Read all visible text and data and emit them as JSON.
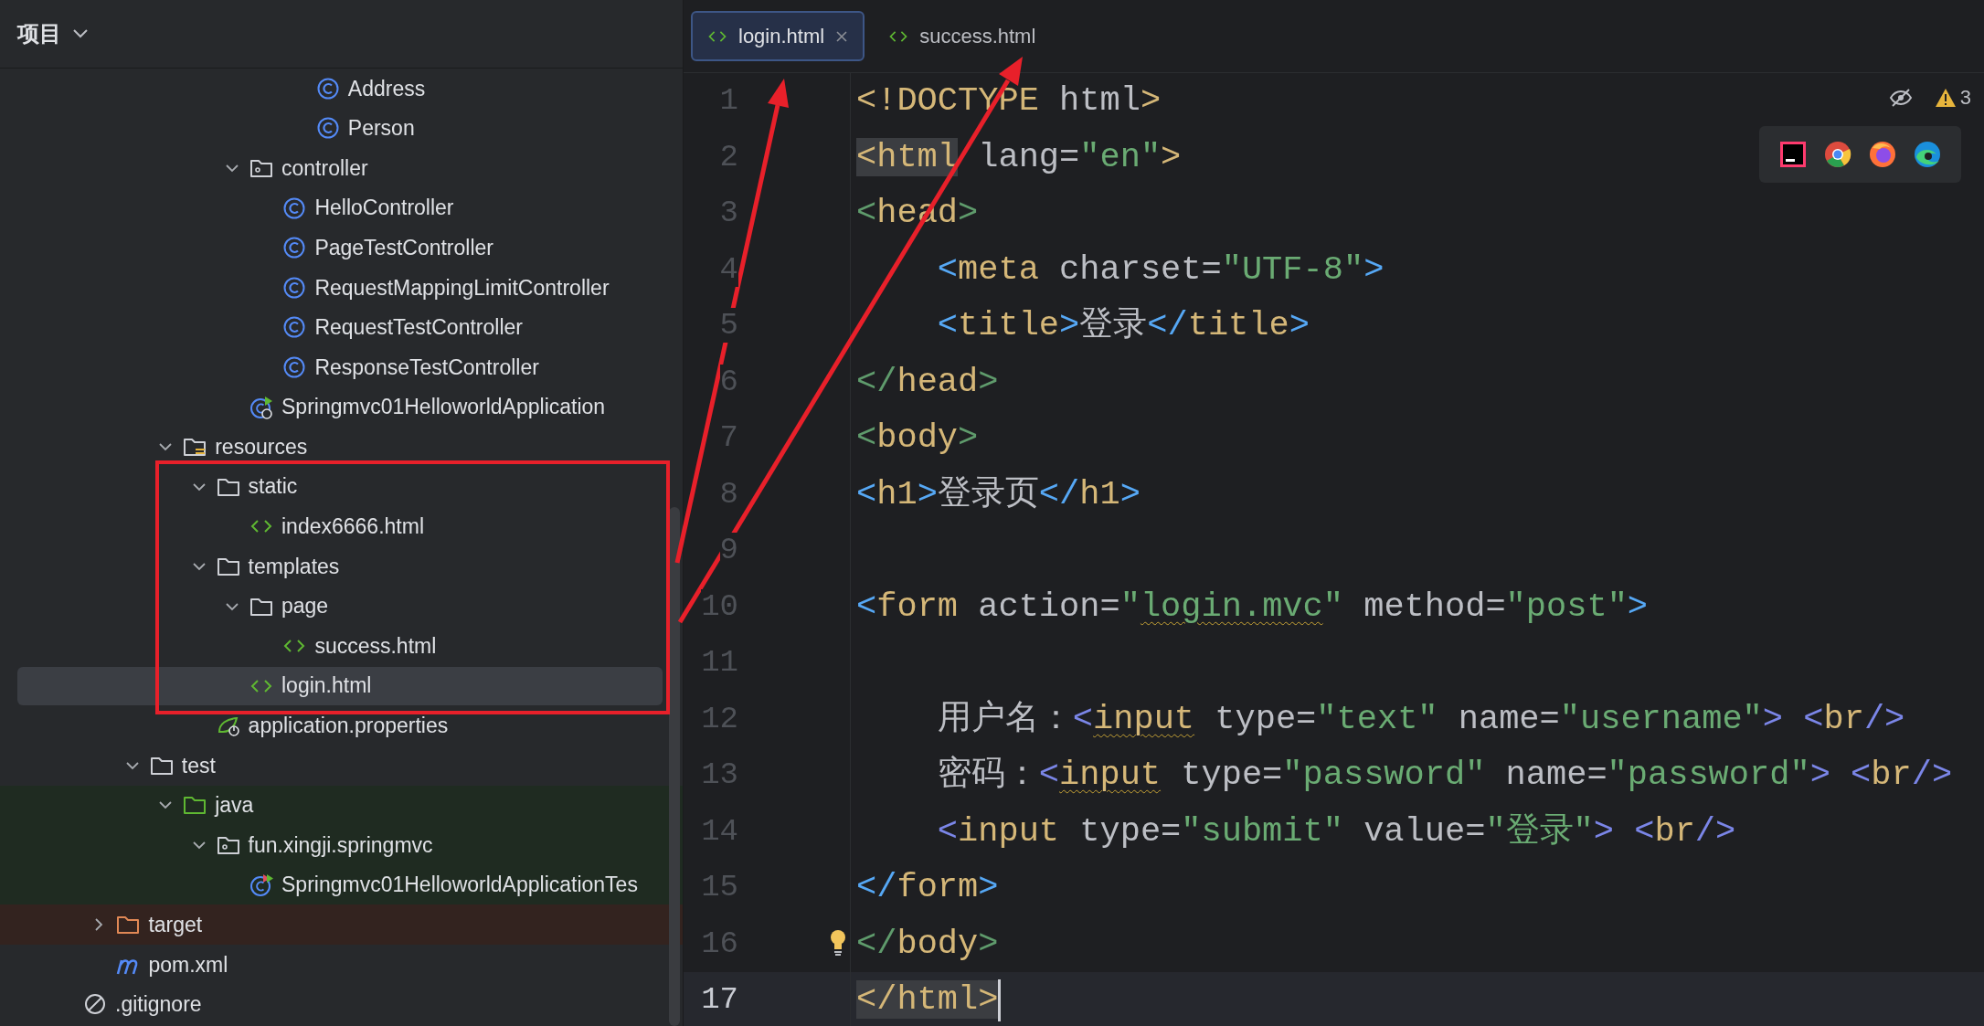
{
  "project_panel": {
    "title": "项目",
    "tree": [
      {
        "children": [
          {
            "children": [
              {
                "children": [
                  {
                    "children": [
                      {
                        "children": [
                          {
                            "children": [
                              {
                                "children": [
                                  {
                                    "label": "Address",
                                    "kind": "class",
                                    "selected": false
                                  },
                                  {
                                    "label": "Person",
                                    "kind": "class",
                                    "selected": false
                                  }
                                ]
                              }
                            ]
                          },
                          {
                            "label": "controller",
                            "kind": "package",
                            "expanded": true,
                            "selected": false,
                            "children": [
                              {
                                "label": "HelloController",
                                "kind": "class",
                                "selected": false
                              },
                              {
                                "label": "PageTestController",
                                "kind": "class",
                                "selected": false
                              },
                              {
                                "label": "RequestMappingLimitController",
                                "kind": "class",
                                "selected": false
                              },
                              {
                                "label": "RequestTestController",
                                "kind": "class",
                                "selected": false
                              },
                              {
                                "label": "ResponseTestController",
                                "kind": "class",
                                "selected": false
                              }
                            ]
                          },
                          {
                            "label": "Springmvc01HelloworldApplication",
                            "kind": "app",
                            "selected": false
                          }
                        ]
                      }
                    ]
                  },
                  {
                    "label": "resources",
                    "kind": "resources",
                    "expanded": true,
                    "selected": false,
                    "children": [
                      {
                        "label": "static",
                        "kind": "folder",
                        "expanded": true,
                        "selected": false,
                        "children": [
                          {
                            "label": "index6666.html",
                            "kind": "html",
                            "selected": false
                          }
                        ]
                      },
                      {
                        "label": "templates",
                        "kind": "folder",
                        "expanded": true,
                        "selected": false,
                        "children": [
                          {
                            "label": "page",
                            "kind": "folder",
                            "expanded": true,
                            "selected": false,
                            "children": [
                              {
                                "label": "success.html",
                                "kind": "html",
                                "selected": false
                              }
                            ]
                          },
                          {
                            "label": "login.html",
                            "kind": "html",
                            "selected": true
                          }
                        ]
                      },
                      {
                        "label": "application.properties",
                        "kind": "properties",
                        "selected": false
                      }
                    ]
                  }
                ]
              },
              {
                "label": "test",
                "kind": "folder",
                "expanded": true,
                "selected": false,
                "children": [
                  {
                    "label": "java",
                    "kind": "test-folder",
                    "expanded": true,
                    "selected": false,
                    "children": [
                      {
                        "label": "fun.xingji.springmvc",
                        "kind": "test-package",
                        "expanded": true,
                        "selected": false,
                        "children": [
                          {
                            "label": "Springmvc01HelloworldApplicationTes",
                            "kind": "test-class",
                            "selected": false
                          }
                        ]
                      }
                    ]
                  }
                ]
              }
            ]
          },
          {
            "label": "target",
            "kind": "excluded-folder",
            "expanded": false,
            "selected": false
          },
          {
            "label": "pom.xml",
            "kind": "maven",
            "selected": false
          }
        ]
      },
      {
        "label": ".gitignore",
        "kind": "ignored",
        "selected": false
      }
    ]
  },
  "editor": {
    "tabs": [
      {
        "label": "login.html",
        "selected": true
      },
      {
        "label": "success.html",
        "selected": false
      }
    ],
    "problems": {
      "count": "3"
    },
    "lines": [
      {
        "number": "1",
        "current": false,
        "bulb": false,
        "tokens": [
          {
            "text": "<!DOCTYPE",
            "kind": "tag"
          },
          {
            "text": " html",
            "kind": "attr"
          },
          {
            "text": ">",
            "kind": "tag"
          }
        ]
      },
      {
        "number": "2",
        "current": false,
        "bulb": false,
        "tokens": [
          {
            "text": "<html",
            "kind": "tag",
            "highlight": true
          },
          {
            "text": " lang=",
            "kind": "attr"
          },
          {
            "text": "\"en\"",
            "kind": "value"
          },
          {
            "text": ">",
            "kind": "tag"
          }
        ]
      },
      {
        "number": "3",
        "current": false,
        "bulb": false,
        "tokens": [
          {
            "text": "<",
            "kind": "bracket-green"
          },
          {
            "text": "head",
            "kind": "tag"
          },
          {
            "text": ">",
            "kind": "bracket-green"
          }
        ]
      },
      {
        "number": "4",
        "current": false,
        "bulb": false,
        "tokens": [
          {
            "text": "    <",
            "kind": "bracket"
          },
          {
            "text": "meta",
            "kind": "tag"
          },
          {
            "text": " charset=",
            "kind": "attr"
          },
          {
            "text": "\"UTF-8\"",
            "kind": "value"
          },
          {
            "text": ">",
            "kind": "bracket"
          }
        ]
      },
      {
        "number": "5",
        "current": false,
        "bulb": false,
        "tokens": [
          {
            "text": "    <",
            "kind": "bracket"
          },
          {
            "text": "title",
            "kind": "tag"
          },
          {
            "text": ">",
            "kind": "bracket"
          },
          {
            "text": "登录",
            "kind": "text"
          },
          {
            "text": "</",
            "kind": "bracket"
          },
          {
            "text": "title",
            "kind": "tag"
          },
          {
            "text": ">",
            "kind": "bracket"
          }
        ]
      },
      {
        "number": "6",
        "current": false,
        "bulb": false,
        "tokens": [
          {
            "text": "</",
            "kind": "bracket-green"
          },
          {
            "text": "head",
            "kind": "tag"
          },
          {
            "text": ">",
            "kind": "bracket-green"
          }
        ]
      },
      {
        "number": "7",
        "current": false,
        "bulb": false,
        "tokens": [
          {
            "text": "<",
            "kind": "bracket-green"
          },
          {
            "text": "body",
            "kind": "tag"
          },
          {
            "text": ">",
            "kind": "bracket-green"
          }
        ]
      },
      {
        "number": "8",
        "current": false,
        "bulb": false,
        "tokens": [
          {
            "text": "<",
            "kind": "bracket"
          },
          {
            "text": "h1",
            "kind": "tag"
          },
          {
            "text": ">",
            "kind": "bracket"
          },
          {
            "text": "登录页",
            "kind": "text"
          },
          {
            "text": "</",
            "kind": "bracket"
          },
          {
            "text": "h1",
            "kind": "tag"
          },
          {
            "text": ">",
            "kind": "bracket"
          }
        ]
      },
      {
        "number": "9",
        "current": false,
        "bulb": false
      },
      {
        "number": "10",
        "current": false,
        "bulb": false,
        "tokens": [
          {
            "text": "<",
            "kind": "bracket"
          },
          {
            "text": "form",
            "kind": "tag"
          },
          {
            "text": " action=",
            "kind": "attr"
          },
          {
            "text": "\"",
            "kind": "value"
          },
          {
            "text": "login.mvc",
            "kind": "value",
            "warning": true
          },
          {
            "text": "\"",
            "kind": "value"
          },
          {
            "text": " method=",
            "kind": "attr"
          },
          {
            "text": "\"post\"",
            "kind": "value"
          },
          {
            "text": ">",
            "kind": "bracket"
          }
        ]
      },
      {
        "number": "11",
        "current": false,
        "bulb": false
      },
      {
        "number": "12",
        "current": false,
        "bulb": false,
        "tokens": [
          {
            "text": "    用户名：",
            "kind": "text"
          },
          {
            "text": "<",
            "kind": "bracket-void"
          },
          {
            "text": "input",
            "kind": "tag",
            "warning": true
          },
          {
            "text": " type=",
            "kind": "attr"
          },
          {
            "text": "\"text\"",
            "kind": "value"
          },
          {
            "text": " name=",
            "kind": "attr"
          },
          {
            "text": "\"username\"",
            "kind": "value"
          },
          {
            "text": ">",
            "kind": "bracket-void"
          },
          {
            "text": " <",
            "kind": "bracket-void"
          },
          {
            "text": "br",
            "kind": "tag"
          },
          {
            "text": "/>",
            "kind": "bracket-void"
          }
        ]
      },
      {
        "number": "13",
        "current": false,
        "bulb": false,
        "tokens": [
          {
            "text": "    密码：",
            "kind": "text"
          },
          {
            "text": "<",
            "kind": "bracket-void"
          },
          {
            "text": "input",
            "kind": "tag",
            "warning": true
          },
          {
            "text": " type=",
            "kind": "attr"
          },
          {
            "text": "\"password\"",
            "kind": "value"
          },
          {
            "text": " name=",
            "kind": "attr"
          },
          {
            "text": "\"password\"",
            "kind": "value"
          },
          {
            "text": ">",
            "kind": "bracket-void"
          },
          {
            "text": " <",
            "kind": "bracket-void"
          },
          {
            "text": "br",
            "kind": "tag"
          },
          {
            "text": "/>",
            "kind": "bracket-void"
          }
        ]
      },
      {
        "number": "14",
        "current": false,
        "bulb": false,
        "tokens": [
          {
            "text": "    <",
            "kind": "bracket-void"
          },
          {
            "text": "input",
            "kind": "tag"
          },
          {
            "text": " type=",
            "kind": "attr"
          },
          {
            "text": "\"submit\"",
            "kind": "value"
          },
          {
            "text": " value=",
            "kind": "attr"
          },
          {
            "text": "\"登录\"",
            "kind": "value"
          },
          {
            "text": ">",
            "kind": "bracket-void"
          },
          {
            "text": " <",
            "kind": "bracket-void"
          },
          {
            "text": "br",
            "kind": "tag"
          },
          {
            "text": "/>",
            "kind": "bracket-void"
          }
        ]
      },
      {
        "number": "15",
        "current": false,
        "bulb": false,
        "tokens": [
          {
            "text": "</",
            "kind": "bracket"
          },
          {
            "text": "form",
            "kind": "tag"
          },
          {
            "text": ">",
            "kind": "bracket"
          }
        ]
      },
      {
        "number": "16",
        "current": false,
        "bulb": true,
        "tokens": [
          {
            "text": "</",
            "kind": "bracket-green"
          },
          {
            "text": "body",
            "kind": "tag"
          },
          {
            "text": ">",
            "kind": "bracket-green"
          }
        ]
      },
      {
        "number": "17",
        "current": true,
        "bulb": false,
        "tokens": [
          {
            "text": "</html>",
            "kind": "tag",
            "highlight": true
          }
        ]
      }
    ]
  }
}
